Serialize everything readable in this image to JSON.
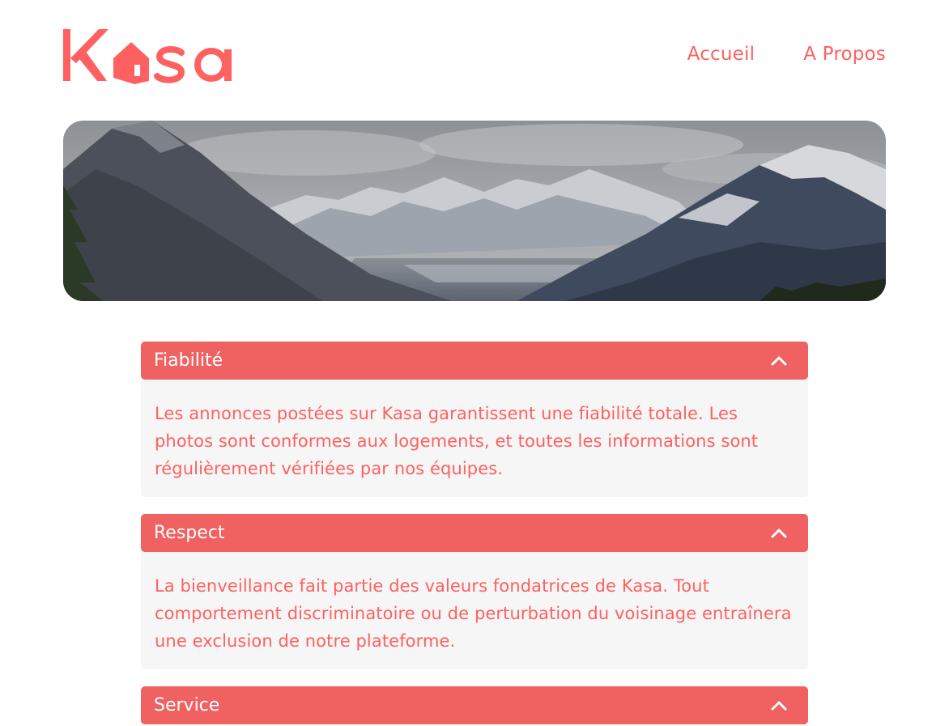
{
  "brand": {
    "name": "Kasa",
    "accent_color": "#FF6060"
  },
  "nav": {
    "items": [
      {
        "label": "Accueil"
      },
      {
        "label": "A Propos"
      }
    ]
  },
  "banner": {
    "alt": "mountain-landscape-banner"
  },
  "collapses": [
    {
      "title": "Fiabilité",
      "icon": "chevron-up-icon",
      "text": "Les annonces postées sur Kasa garantissent une fiabilité totale. Les photos sont conformes aux logements, et toutes les informations sont régulièrement vérifiées par nos équipes."
    },
    {
      "title": "Respect",
      "icon": "chevron-up-icon",
      "text": "La bienveillance fait partie des valeurs fondatrices de Kasa. Tout comportement discriminatoire ou de perturbation du voisinage entraînera une exclusion de notre plateforme."
    },
    {
      "title": "Service",
      "icon": "chevron-up-icon",
      "text": ""
    }
  ]
}
